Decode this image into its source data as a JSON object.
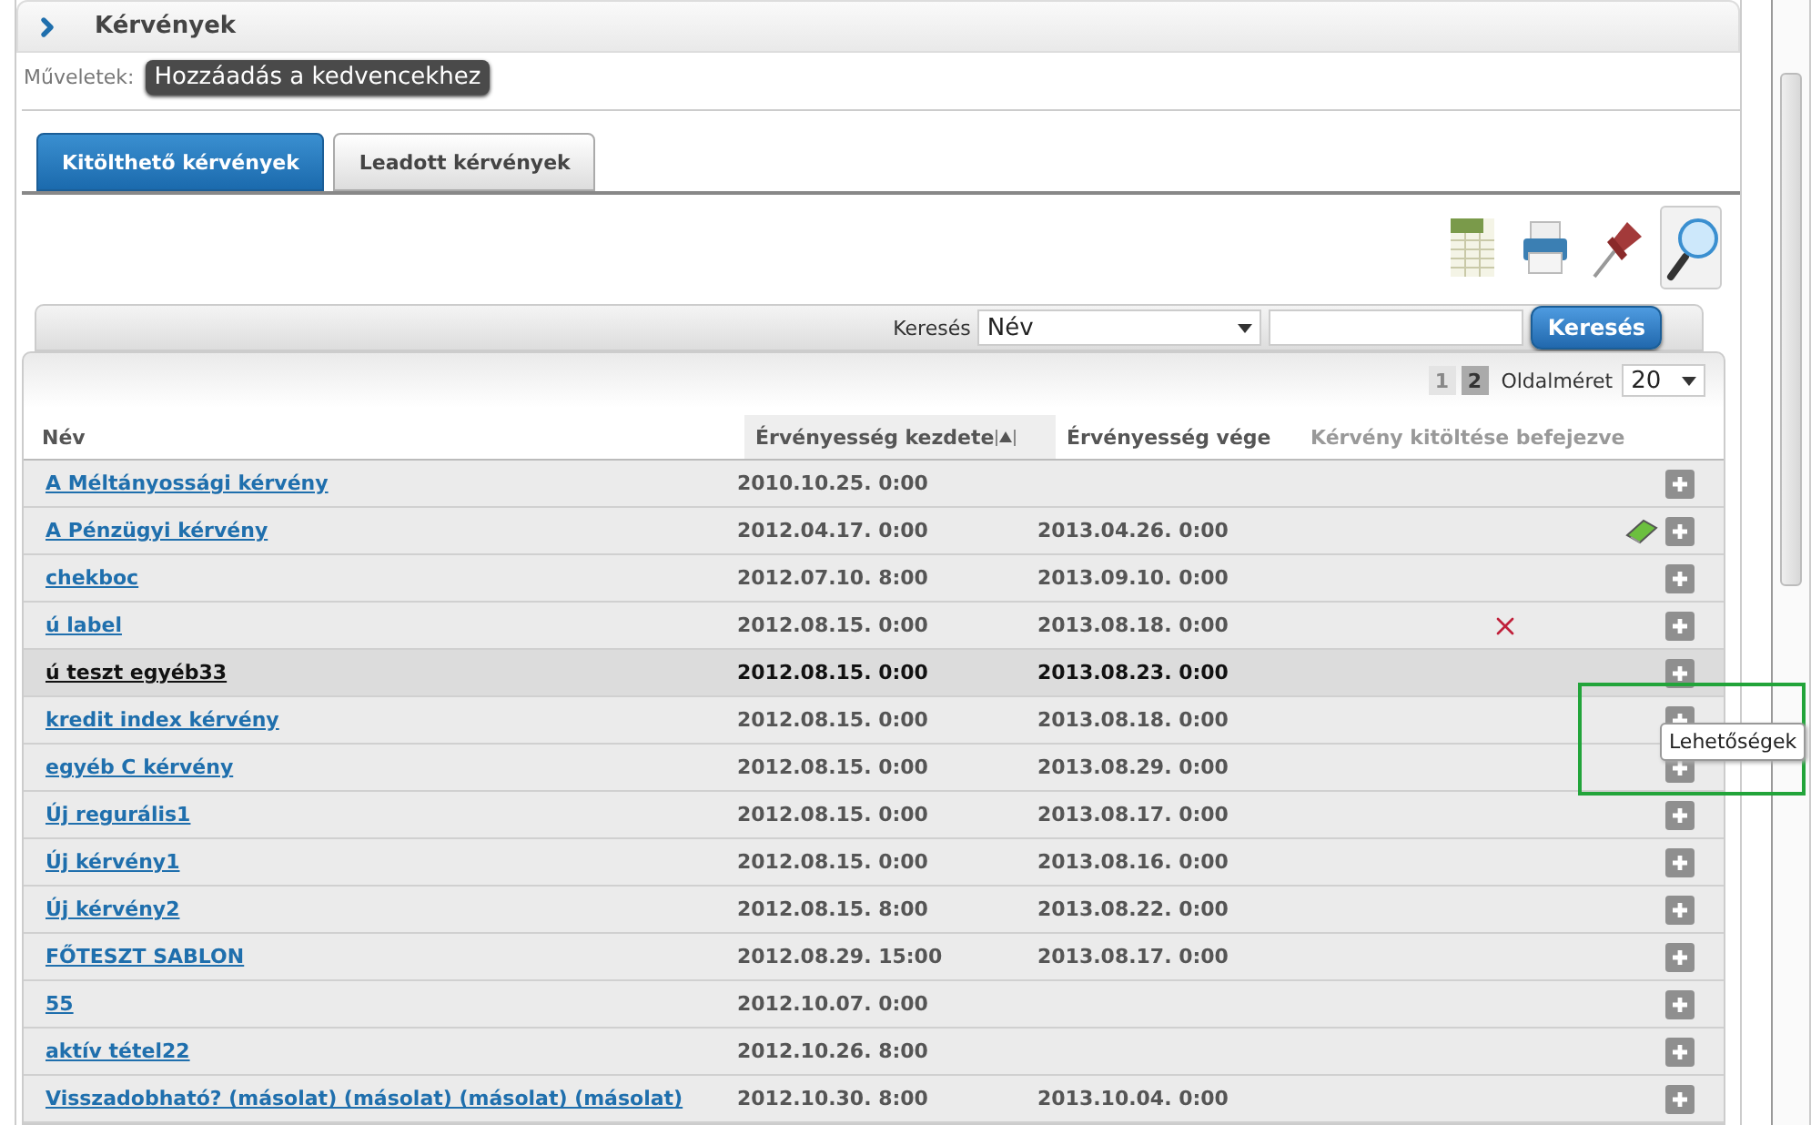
{
  "header": {
    "title": "Kérvények"
  },
  "actions": {
    "label": "Műveletek:",
    "buttons": [
      "Hozzáadás a kedvencekhez"
    ]
  },
  "tabs": [
    {
      "label": "Kitölthető kérvények",
      "selected": true
    },
    {
      "label": "Leadott kérvények",
      "selected": false
    }
  ],
  "toolbar": [
    {
      "kind": "excel",
      "selected": false
    },
    {
      "kind": "print",
      "selected": false
    },
    {
      "kind": "pin",
      "selected": false
    },
    {
      "kind": "search",
      "selected": true
    }
  ],
  "search": {
    "label": "Keresés",
    "field": "Név",
    "button": "Keresés"
  },
  "pager": {
    "pages": [
      {
        "label": "1",
        "selected": false
      },
      {
        "label": "2",
        "selected": true
      }
    ],
    "size_label": "Oldalméret",
    "size": "20"
  },
  "table": {
    "columns": [
      {
        "label": "Név",
        "sorted": false,
        "enabled": true
      },
      {
        "label": "Érvényesség kezdete",
        "sorted": true,
        "enabled": true
      },
      {
        "label": "Érvényesség vége",
        "sorted": false,
        "enabled": true
      },
      {
        "label": "Kérvény kitöltése befejezve",
        "sorted": false,
        "enabled": false
      }
    ],
    "rows": [
      {
        "name": "A Méltányossági kérvény",
        "start": "2010.10.25. 0:00",
        "end": "",
        "kind": "plain",
        "hovered": false
      },
      {
        "name": "A Pénzügyi kérvény",
        "start": "2012.04.17. 0:00",
        "end": "2013.04.26. 0:00",
        "kind": "book",
        "hovered": false
      },
      {
        "name": "chekboc",
        "start": "2012.07.10. 8:00",
        "end": "2013.09.10. 0:00",
        "kind": "plain",
        "hovered": false
      },
      {
        "name": "ú label",
        "start": "2012.08.15. 0:00",
        "end": "2013.08.18. 0:00",
        "kind": "cross",
        "hovered": false
      },
      {
        "name": "ú teszt egyéb33",
        "start": "2012.08.15. 0:00",
        "end": "2013.08.23. 0:00",
        "kind": "plain",
        "hovered": true
      },
      {
        "name": "kredit index kérvény",
        "start": "2012.08.15. 0:00",
        "end": "2013.08.18. 0:00",
        "kind": "plain",
        "hovered": false
      },
      {
        "name": "egyéb C kérvény",
        "start": "2012.08.15. 0:00",
        "end": "2013.08.29. 0:00",
        "kind": "plain",
        "hovered": false
      },
      {
        "name": "Új regurális1",
        "start": "2012.08.15. 0:00",
        "end": "2013.08.17. 0:00",
        "kind": "plain",
        "hovered": false
      },
      {
        "name": "Új kérvény1",
        "start": "2012.08.15. 0:00",
        "end": "2013.08.16. 0:00",
        "kind": "plain",
        "hovered": false
      },
      {
        "name": "Új kérvény2",
        "start": "2012.08.15. 8:00",
        "end": "2013.08.22. 0:00",
        "kind": "plain",
        "hovered": false
      },
      {
        "name": "FŐTESZT SABLON",
        "start": "2012.08.29. 15:00",
        "end": "2013.08.17. 0:00",
        "kind": "plain",
        "hovered": false
      },
      {
        "name": "55",
        "start": "2012.10.07. 0:00",
        "end": "",
        "kind": "plain",
        "hovered": false
      },
      {
        "name": "aktív tétel22",
        "start": "2012.10.26. 8:00",
        "end": "",
        "kind": "plain",
        "hovered": false
      },
      {
        "name": "Visszadobható? (másolat) (másolat) (másolat) (másolat)",
        "start": "2012.10.30. 8:00",
        "end": "2013.10.04. 0:00",
        "kind": "plain",
        "hovered": false
      }
    ]
  },
  "tooltip": "Lehetőségek"
}
